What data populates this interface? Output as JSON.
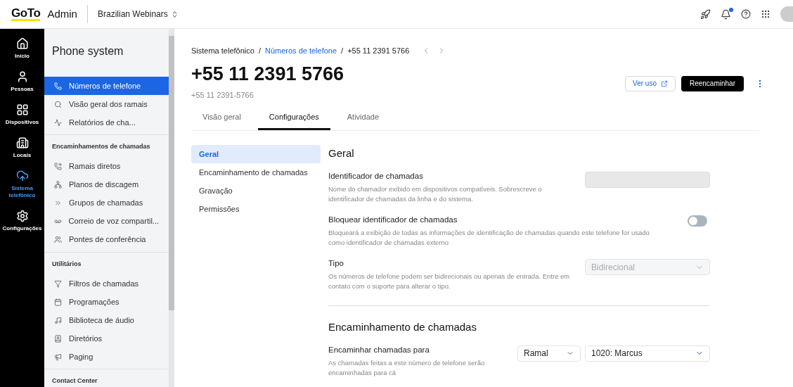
{
  "topbar": {
    "logo": "GoTo",
    "app": "Admin",
    "account": "Brazilian Webinars",
    "notification_dot": true
  },
  "rail": [
    {
      "label": "Início",
      "selected": false
    },
    {
      "label": "Pessoas",
      "selected": false
    },
    {
      "label": "Dispositivos",
      "selected": false
    },
    {
      "label": "Locais",
      "selected": false
    },
    {
      "label": "Sistema telefônico",
      "selected": true
    },
    {
      "label": "Configurações",
      "selected": false
    }
  ],
  "sidebar": {
    "title": "Phone system",
    "sections": [
      {
        "items": [
          {
            "label": "Números de telefone",
            "selected": true
          },
          {
            "label": "Visão geral dos ramais",
            "selected": false
          },
          {
            "label": "Relatórios de cha...",
            "selected": false
          }
        ]
      },
      {
        "heading": "Encaminhamentos de chamadas",
        "items": [
          {
            "label": "Ramais diretos",
            "selected": false
          },
          {
            "label": "Planos de discagem",
            "selected": false
          },
          {
            "label": "Grupos de chamadas",
            "selected": false
          },
          {
            "label": "Correio de voz compartil...",
            "selected": false
          },
          {
            "label": "Pontes de conferência",
            "selected": false
          }
        ]
      },
      {
        "heading": "Utilitários",
        "items": [
          {
            "label": "Filtros de chamadas",
            "selected": false
          },
          {
            "label": "Programações",
            "selected": false
          },
          {
            "label": "Biblioteca de áudio",
            "selected": false
          },
          {
            "label": "Diretórios",
            "selected": false
          },
          {
            "label": "Paging",
            "selected": false
          }
        ]
      },
      {
        "heading": "Contact Center"
      }
    ]
  },
  "breadcrumb": [
    {
      "label": "Sistema telefônico",
      "kind": "text"
    },
    {
      "label": "/",
      "kind": "separator"
    },
    {
      "label": "Números de telefone",
      "kind": "link"
    },
    {
      "label": "/",
      "kind": "separator"
    },
    {
      "label": "+55 11 2391 5766",
      "kind": "text"
    }
  ],
  "title": "+55 11 2391 5766",
  "subtitle": "+55 11 2391-5766",
  "actions": {
    "secondary": "Ver uso",
    "primary": "Reencaminhar"
  },
  "tabs": [
    {
      "label": "Visão geral",
      "selected": false
    },
    {
      "label": "Configurações",
      "selected": true
    },
    {
      "label": "Atividade",
      "selected": false
    }
  ],
  "subnav": [
    {
      "label": "Geral",
      "selected": true
    },
    {
      "label": "Encaminhamento de chamadas",
      "selected": false
    },
    {
      "label": "Gravação",
      "selected": false
    },
    {
      "label": "Permissões",
      "selected": false
    }
  ],
  "sections": [
    {
      "title": "Geral",
      "settings": [
        {
          "kind": "input",
          "label": "Identificador de chamadas",
          "description": "Nome do chamador exibido em dispositivos compatíveis. Sobrescreve o identificador de chamadas da linha e do sistema.",
          "disabled": true
        },
        {
          "kind": "toggle",
          "label": "Bloquear identificador de chamadas",
          "description": "Bloqueará a exibição de todas as informações de identificação de chamadas quando este telefone for usado como identificador de chamadas externo",
          "on": false
        },
        {
          "kind": "select",
          "label": "Tipo",
          "description": "Os números de telefone podem ser bidirecionais ou apenas de entrada. Entre em contato com o suporte para alterar o tipo.",
          "value": "Bidirecional",
          "disabled": true
        }
      ]
    },
    {
      "title": "Encaminhamento de chamadas",
      "settings": [
        {
          "kind": "select_pair",
          "label": "Encaminhar chamadas para",
          "description": "As chamadas feitas a este número de telefone serão encaminhadas para cá",
          "value": "Ramal",
          "value_2": "1020: Marcus"
        }
      ]
    }
  ]
}
